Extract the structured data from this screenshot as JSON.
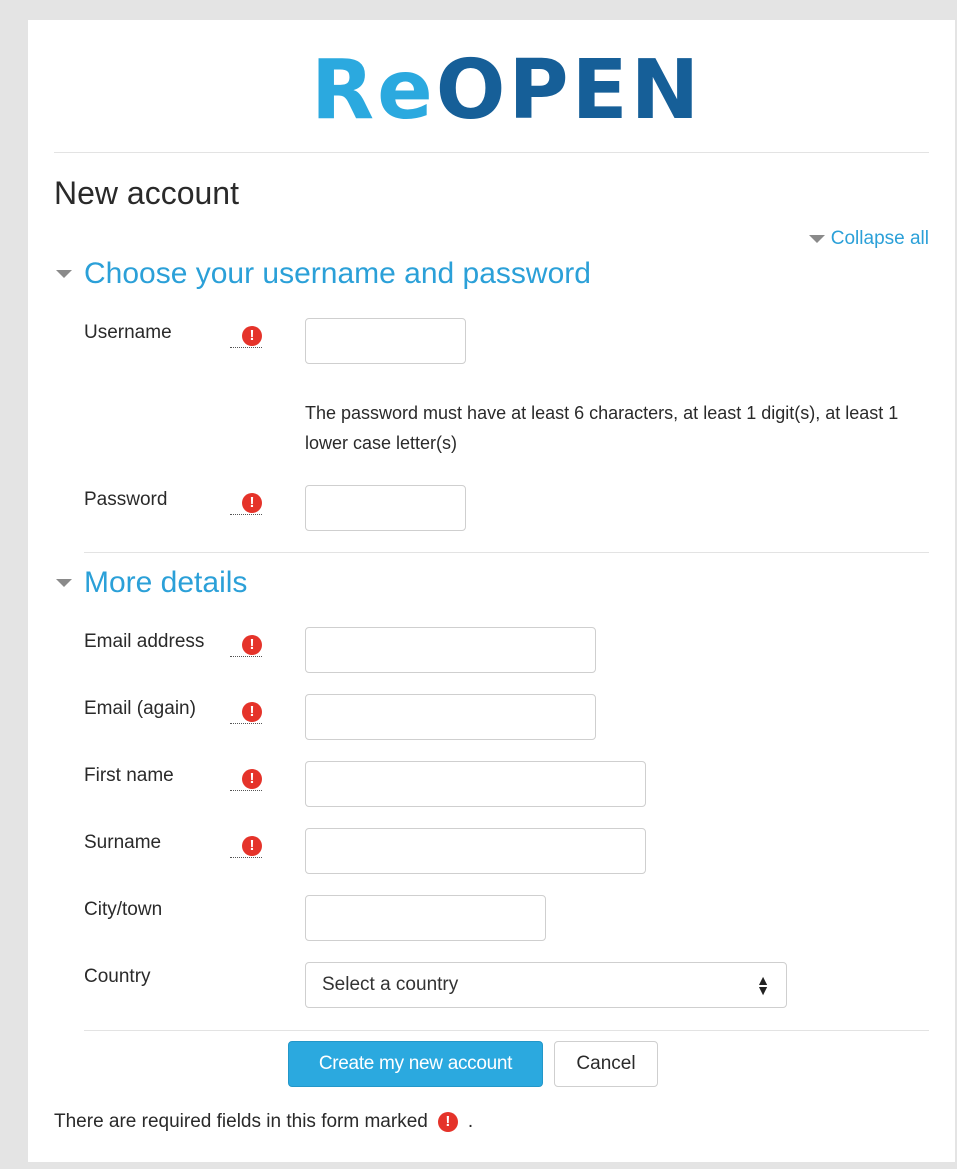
{
  "logo": {
    "part1": "Re",
    "part2": "OPEN"
  },
  "page_title": "New account",
  "collapse_all": "Collapse all",
  "sections": [
    {
      "title": "Choose your username and password",
      "expanded": true
    },
    {
      "title": "More details",
      "expanded": true
    }
  ],
  "fields": {
    "username": {
      "label": "Username",
      "value": "",
      "required": true
    },
    "password_help": "The password must have at least 6 characters, at least 1 digit(s), at least 1 lower case letter(s)",
    "password": {
      "label": "Password",
      "value": "",
      "required": true
    },
    "email": {
      "label": "Email address",
      "value": "",
      "required": true
    },
    "email2": {
      "label": "Email (again)",
      "value": "",
      "required": true
    },
    "firstname": {
      "label": "First name",
      "value": "",
      "required": true
    },
    "surname": {
      "label": "Surname",
      "value": "",
      "required": true
    },
    "city": {
      "label": "City/town",
      "value": "",
      "required": false
    },
    "country": {
      "label": "Country",
      "selected": "Select a country",
      "required": false
    }
  },
  "buttons": {
    "submit": "Create my new account",
    "cancel": "Cancel"
  },
  "required_icon_glyph": "!",
  "required_note": {
    "text": "There are required fields in this form marked",
    "suffix": "."
  },
  "colors": {
    "accent": "#2ba9df",
    "logo_dark": "#165f98",
    "required": "#e5332a"
  }
}
